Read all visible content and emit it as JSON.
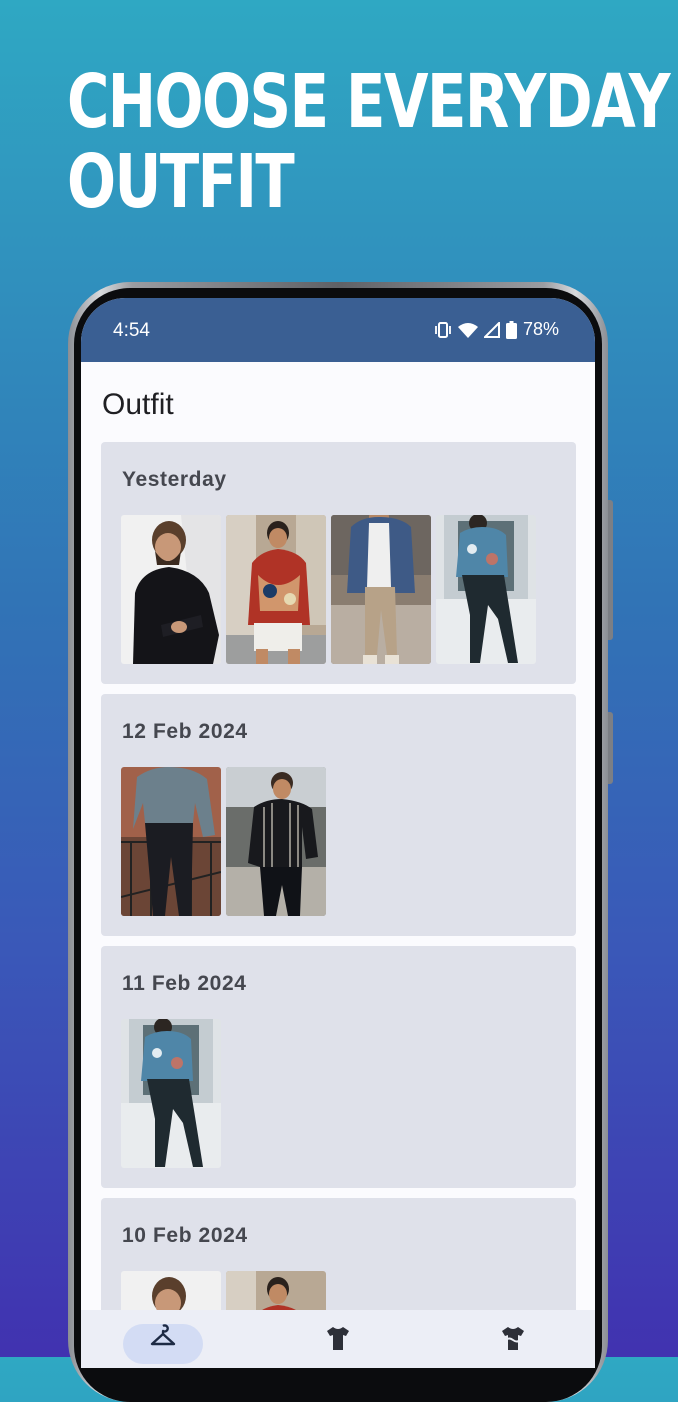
{
  "headline": {
    "line1": "CHOOSE EVERYDAY",
    "line2": "OUTFIT"
  },
  "status_bar": {
    "time": "4:54",
    "battery": "78%",
    "icons": [
      "vibrate-icon",
      "wifi-icon",
      "signal-icon",
      "battery-icon"
    ]
  },
  "app": {
    "title": "Outfit"
  },
  "outfits": [
    {
      "date": "Yesterday",
      "photo_count": 4
    },
    {
      "date": "12 Feb 2024",
      "photo_count": 2
    },
    {
      "date": "11 Feb 2024",
      "photo_count": 1
    },
    {
      "date": "10 Feb 2024",
      "photo_count": 2
    }
  ],
  "bottom_nav": {
    "items": [
      "hanger-icon",
      "tshirt-icon",
      "laundry-icon"
    ],
    "active_index": 0
  },
  "colors": {
    "status_bar": "#3a5f93",
    "card": "#dfe1ea",
    "nav_active": "#d3dcf4"
  }
}
